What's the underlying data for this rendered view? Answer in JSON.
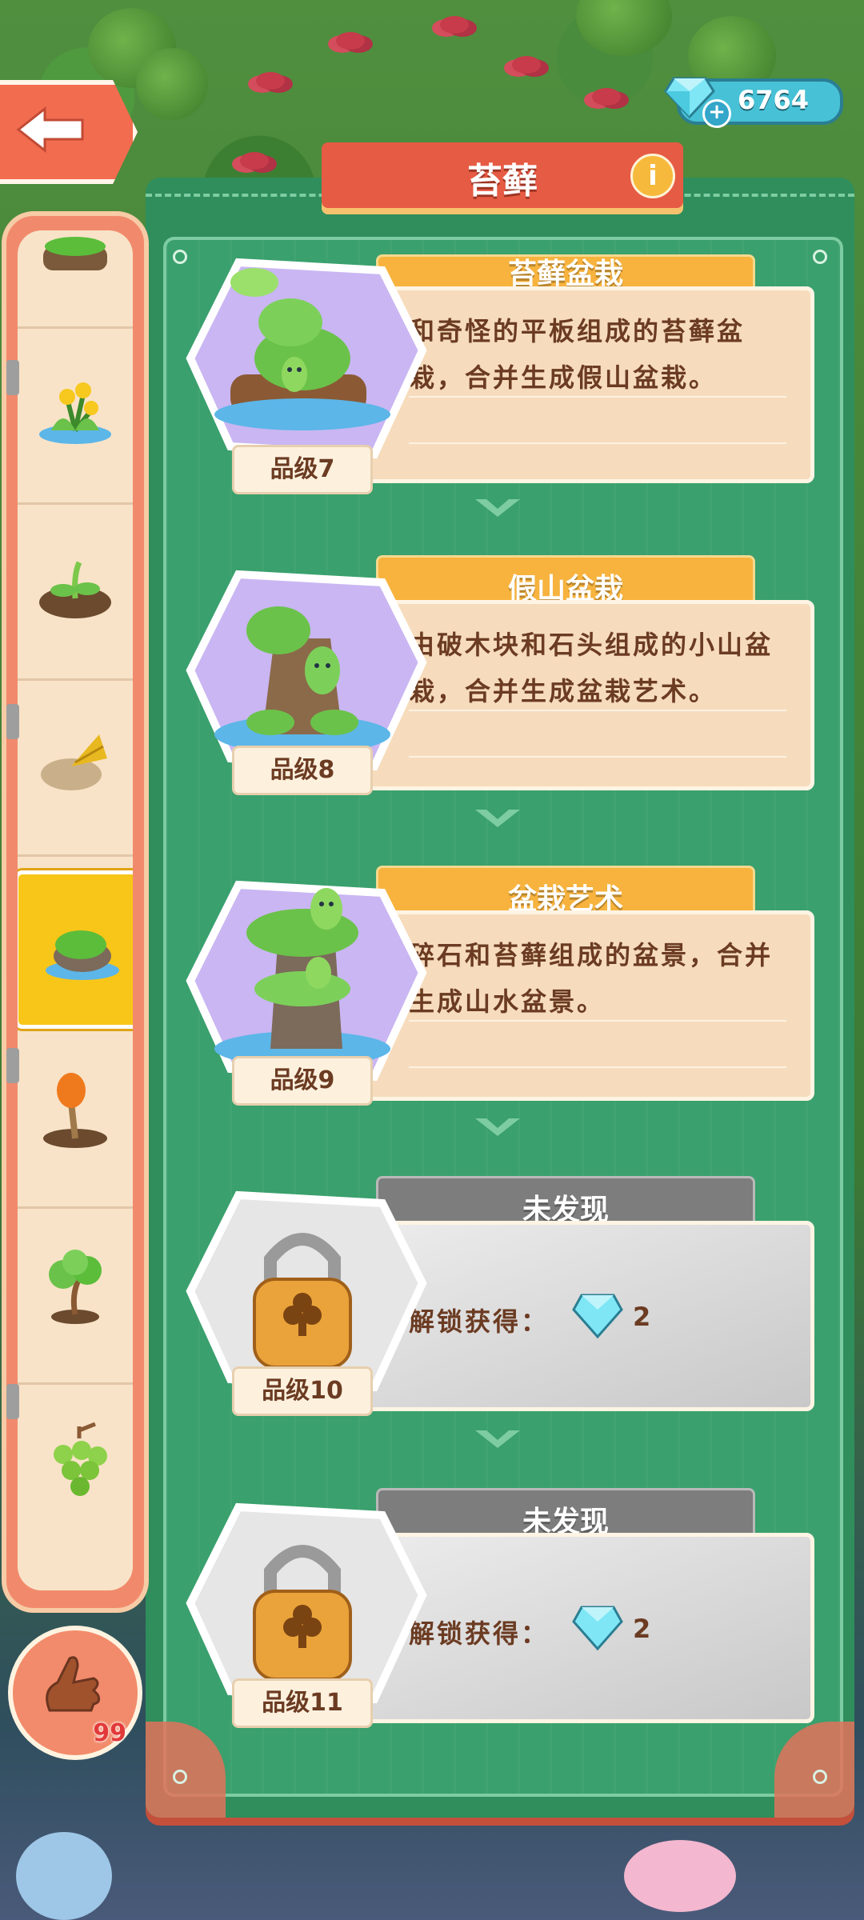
{
  "header": {
    "title": "苔藓",
    "gem_count": "6764",
    "back_icon": "arrow-left-icon",
    "info_icon": "info-icon",
    "info_glyph": "i"
  },
  "rail": {
    "items": [
      {
        "icon": "moss-log-icon"
      },
      {
        "icon": "yellow-flower-icon"
      },
      {
        "icon": "sprout-icon"
      },
      {
        "icon": "leaf-rock-icon"
      },
      {
        "icon": "moss-rock-icon",
        "selected": true
      },
      {
        "icon": "carrot-root-icon"
      },
      {
        "icon": "bonsai-tree-icon"
      },
      {
        "icon": "grapes-icon"
      }
    ],
    "hand_count": "99"
  },
  "cards": [
    {
      "name": "苔藓盆栽",
      "desc": "和奇怪的平板组成的苔藓盆栽，合并生成假山盆栽。",
      "grade": "品级7",
      "locked": false
    },
    {
      "name": "假山盆栽",
      "desc": "由破木块和石头组成的小山盆栽，合并生成盆栽艺术。",
      "grade": "品级8",
      "locked": false
    },
    {
      "name": "盆栽艺术",
      "desc": "碎石和苔藓组成的盆景，合并生成山水盆景。",
      "grade": "品级9",
      "locked": false
    },
    {
      "name": "未发现",
      "unlock_label": "解锁获得：",
      "unlock_count": "2",
      "grade": "品级10",
      "locked": true
    },
    {
      "name": "未发现",
      "unlock_label": "解锁获得：",
      "unlock_count": "2",
      "grade": "品级11",
      "locked": true
    }
  ],
  "colors": {
    "panel_green": "#2f8e5c",
    "title_red": "#e65b44",
    "name_tab_orange": "#f7b33e",
    "locked_gray": "#7d7d7d",
    "selected_yellow": "#f8c619"
  }
}
